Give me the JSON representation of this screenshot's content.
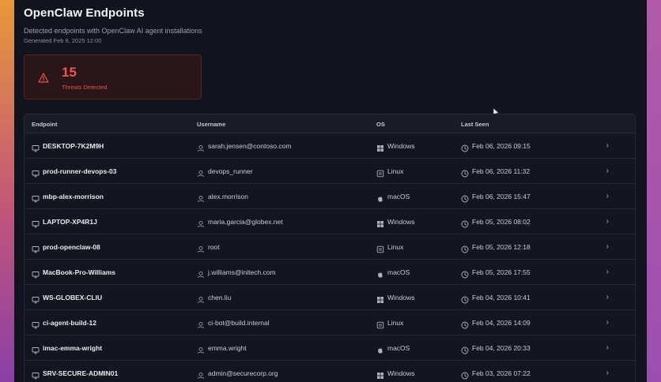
{
  "header": {
    "title": "OpenClaw Endpoints",
    "subtitle": "Detected endpoints with OpenClaw AI agent installations",
    "generated": "Generated Feb 8, 2025 12:00"
  },
  "threats": {
    "count": "15",
    "label": "Threats Detected"
  },
  "colors": {
    "threat": "#f0564e",
    "background": "#12141d"
  },
  "table": {
    "columns": [
      "Endpoint",
      "Username",
      "OS",
      "Last Seen"
    ],
    "rows": [
      {
        "endpoint": "DESKTOP-7K2M9H",
        "username": "sarah.jensen@contoso.com",
        "os": "Windows",
        "last_seen": "Feb 06, 2026 09:15"
      },
      {
        "endpoint": "prod-runner-devops-03",
        "username": "devops_runner",
        "os": "Linux",
        "last_seen": "Feb 06, 2026 11:32"
      },
      {
        "endpoint": "mbp-alex-morrison",
        "username": "alex.morrison",
        "os": "macOS",
        "last_seen": "Feb 06, 2026 15:47"
      },
      {
        "endpoint": "LAPTOP-XP4R1J",
        "username": "maria.garcia@globex.net",
        "os": "Windows",
        "last_seen": "Feb 05, 2026 08:02"
      },
      {
        "endpoint": "prod-openclaw-08",
        "username": "root",
        "os": "Linux",
        "last_seen": "Feb 05, 2026 12:18"
      },
      {
        "endpoint": "MacBook-Pro-Williams",
        "username": "j.williams@initech.com",
        "os": "macOS",
        "last_seen": "Feb 05, 2026 17:55"
      },
      {
        "endpoint": "WS-GLOBEX-CLIU",
        "username": "chen.liu",
        "os": "Windows",
        "last_seen": "Feb 04, 2026 10:41"
      },
      {
        "endpoint": "ci-agent-build-12",
        "username": "ci-bot@build.internal",
        "os": "Linux",
        "last_seen": "Feb 04, 2026 14:09"
      },
      {
        "endpoint": "imac-emma-wright",
        "username": "emma.wright",
        "os": "macOS",
        "last_seen": "Feb 04, 2026 20:33"
      },
      {
        "endpoint": "SRV-SECURE-ADMIN01",
        "username": "admin@securecorp.org",
        "os": "Windows",
        "last_seen": "Feb 03, 2026 07:22"
      }
    ]
  }
}
